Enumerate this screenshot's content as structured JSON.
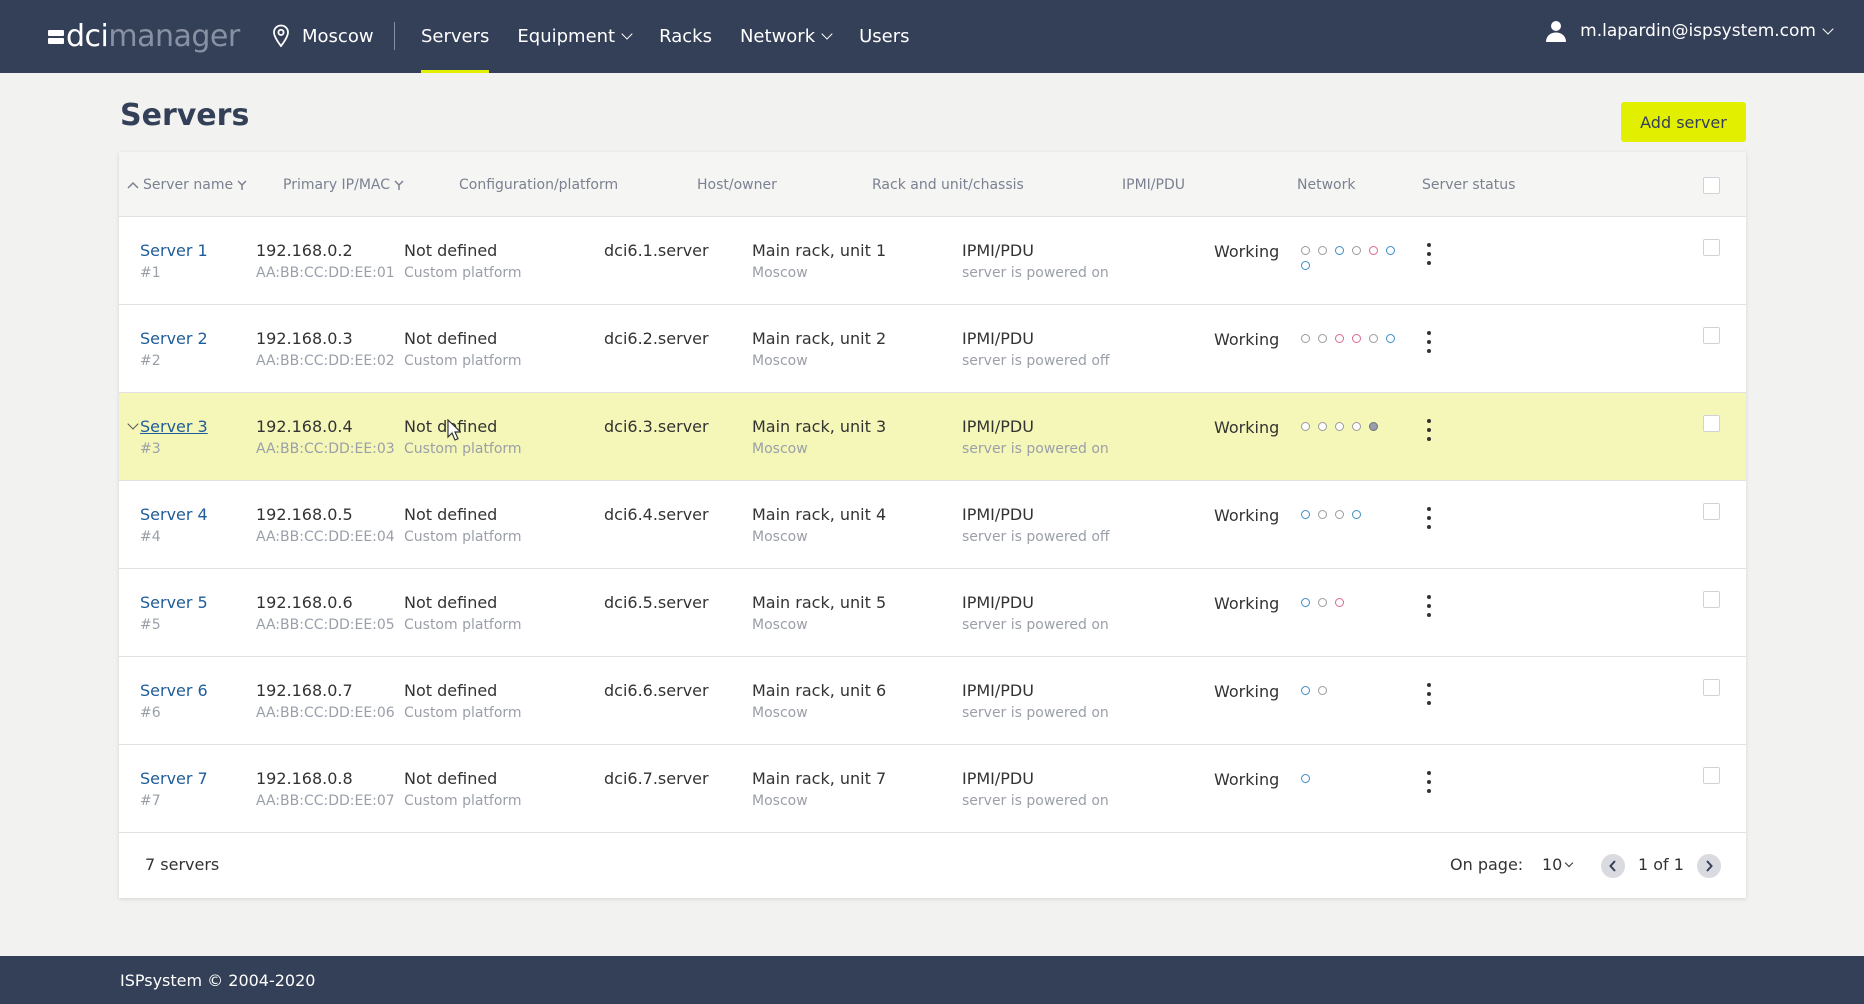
{
  "header": {
    "logo_primary": "dci",
    "logo_secondary": "manager",
    "location": "Moscow",
    "nav": [
      {
        "label": "Servers",
        "active": true,
        "dropdown": false
      },
      {
        "label": "Equipment",
        "active": false,
        "dropdown": true
      },
      {
        "label": "Racks",
        "active": false,
        "dropdown": false
      },
      {
        "label": "Network",
        "active": false,
        "dropdown": true
      },
      {
        "label": "Users",
        "active": false,
        "dropdown": false
      }
    ],
    "user_email": "m.lapardin@ispsystem.com"
  },
  "page": {
    "title": "Servers",
    "add_button": "Add server"
  },
  "table": {
    "columns": {
      "name": "Server name",
      "ip": "Primary IP/MAC",
      "config": "Configuration/platform",
      "host": "Host/owner",
      "rack": "Rack and unit/chassis",
      "ipmi": "IPMI/PDU",
      "network": "Network",
      "status": "Server status"
    },
    "rows": [
      {
        "name": "Server 1",
        "id": "#1",
        "ip": "192.168.0.2",
        "mac": "AA:BB:CC:DD:EE:01",
        "config": "Not defined",
        "platform": "Custom platform",
        "host": "dci6.1.server",
        "rack": "Main rack, unit 1",
        "location": "Moscow",
        "ipmi": "IPMI/PDU",
        "power": "server is powered on",
        "status": "Working",
        "ports": [
          "gray",
          "gray",
          "blue",
          "gray",
          "pink",
          "blue",
          "blue"
        ]
      },
      {
        "name": "Server 2",
        "id": "#2",
        "ip": "192.168.0.3",
        "mac": "AA:BB:CC:DD:EE:02",
        "config": "Not defined",
        "platform": "Custom platform",
        "host": "dci6.2.server",
        "rack": "Main rack, unit 2",
        "location": "Moscow",
        "ipmi": "IPMI/PDU",
        "power": "server is powered off",
        "status": "Working",
        "ports": [
          "gray",
          "gray",
          "pink",
          "pink",
          "gray",
          "blue"
        ]
      },
      {
        "name": "Server 3",
        "id": "#3",
        "ip": "192.168.0.4",
        "mac": "AA:BB:CC:DD:EE:03",
        "config": "Not defined",
        "platform": "Custom platform",
        "host": "dci6.3.server",
        "rack": "Main rack, unit 3",
        "location": "Moscow",
        "ipmi": "IPMI/PDU",
        "power": "server is powered on",
        "status": "Working",
        "ports": [
          "gray",
          "gray",
          "gray",
          "gray",
          "dark"
        ],
        "highlighted": true
      },
      {
        "name": "Server 4",
        "id": "#4",
        "ip": "192.168.0.5",
        "mac": "AA:BB:CC:DD:EE:04",
        "config": "Not defined",
        "platform": "Custom platform",
        "host": "dci6.4.server",
        "rack": "Main rack, unit 4",
        "location": "Moscow",
        "ipmi": "IPMI/PDU",
        "power": "server is powered off",
        "status": "Working",
        "ports": [
          "blue",
          "gray",
          "gray",
          "blue"
        ]
      },
      {
        "name": "Server 5",
        "id": "#5",
        "ip": "192.168.0.6",
        "mac": "AA:BB:CC:DD:EE:05",
        "config": "Not defined",
        "platform": "Custom platform",
        "host": "dci6.5.server",
        "rack": "Main rack, unit 5",
        "location": "Moscow",
        "ipmi": "IPMI/PDU",
        "power": "server is powered on",
        "status": "Working",
        "ports": [
          "blue",
          "gray",
          "pink"
        ]
      },
      {
        "name": "Server 6",
        "id": "#6",
        "ip": "192.168.0.7",
        "mac": "AA:BB:CC:DD:EE:06",
        "config": "Not defined",
        "platform": "Custom platform",
        "host": "dci6.6.server",
        "rack": "Main rack, unit 6",
        "location": "Moscow",
        "ipmi": "IPMI/PDU",
        "power": "server is powered on",
        "status": "Working",
        "ports": [
          "blue",
          "gray"
        ]
      },
      {
        "name": "Server 7",
        "id": "#7",
        "ip": "192.168.0.8",
        "mac": "AA:BB:CC:DD:EE:07",
        "config": "Not defined",
        "platform": "Custom platform",
        "host": "dci6.7.server",
        "rack": "Main rack, unit 7",
        "location": "Moscow",
        "ipmi": "IPMI/PDU",
        "power": "server is powered on",
        "status": "Working",
        "ports": [
          "blue"
        ]
      }
    ],
    "footer": {
      "count": "7 servers",
      "on_page_label": "On page:",
      "on_page_value": "10",
      "page_text": "1 of 1"
    }
  },
  "colors": {
    "topbar": "#343f58",
    "accent": "#e2f000",
    "link": "#1f5c9b",
    "row_highlight": "#f5f7b8"
  },
  "footer": {
    "copyright": "ISPsystem © 2004-2020"
  }
}
